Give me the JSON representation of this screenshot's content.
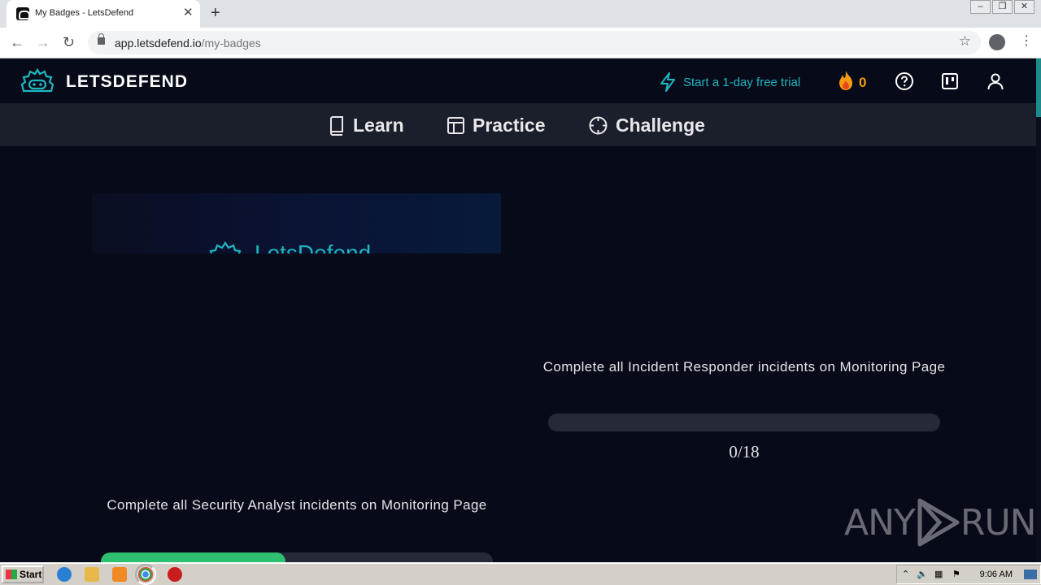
{
  "browser": {
    "tab_title": "My Badges - LetsDefend",
    "url_host": "app.letsdefend.io",
    "url_path": "/my-badges"
  },
  "site": {
    "logo_text": "LETSDEFEND",
    "trial_label": "Start a 1-day free trial",
    "streak_count": "0",
    "nav": {
      "learn": "Learn",
      "practice": "Practice",
      "challenge": "Challenge"
    },
    "badge_image_text": "LetsDefend",
    "cards": [
      {
        "description": "Complete all Security Analyst incidents on Monitoring Page",
        "progress_fraction": 0.47
      },
      {
        "description": "Complete all Incident Responder incidents on Monitoring Page",
        "progress_fraction": 0,
        "count": "0/18"
      }
    ],
    "accent_color": "#1fb6c1",
    "progress_color": "#2fbf71"
  },
  "watermark": {
    "text_left": "ANY",
    "text_right": "RUN"
  },
  "taskbar": {
    "start_label": "Start",
    "clock": "9:06 AM"
  }
}
